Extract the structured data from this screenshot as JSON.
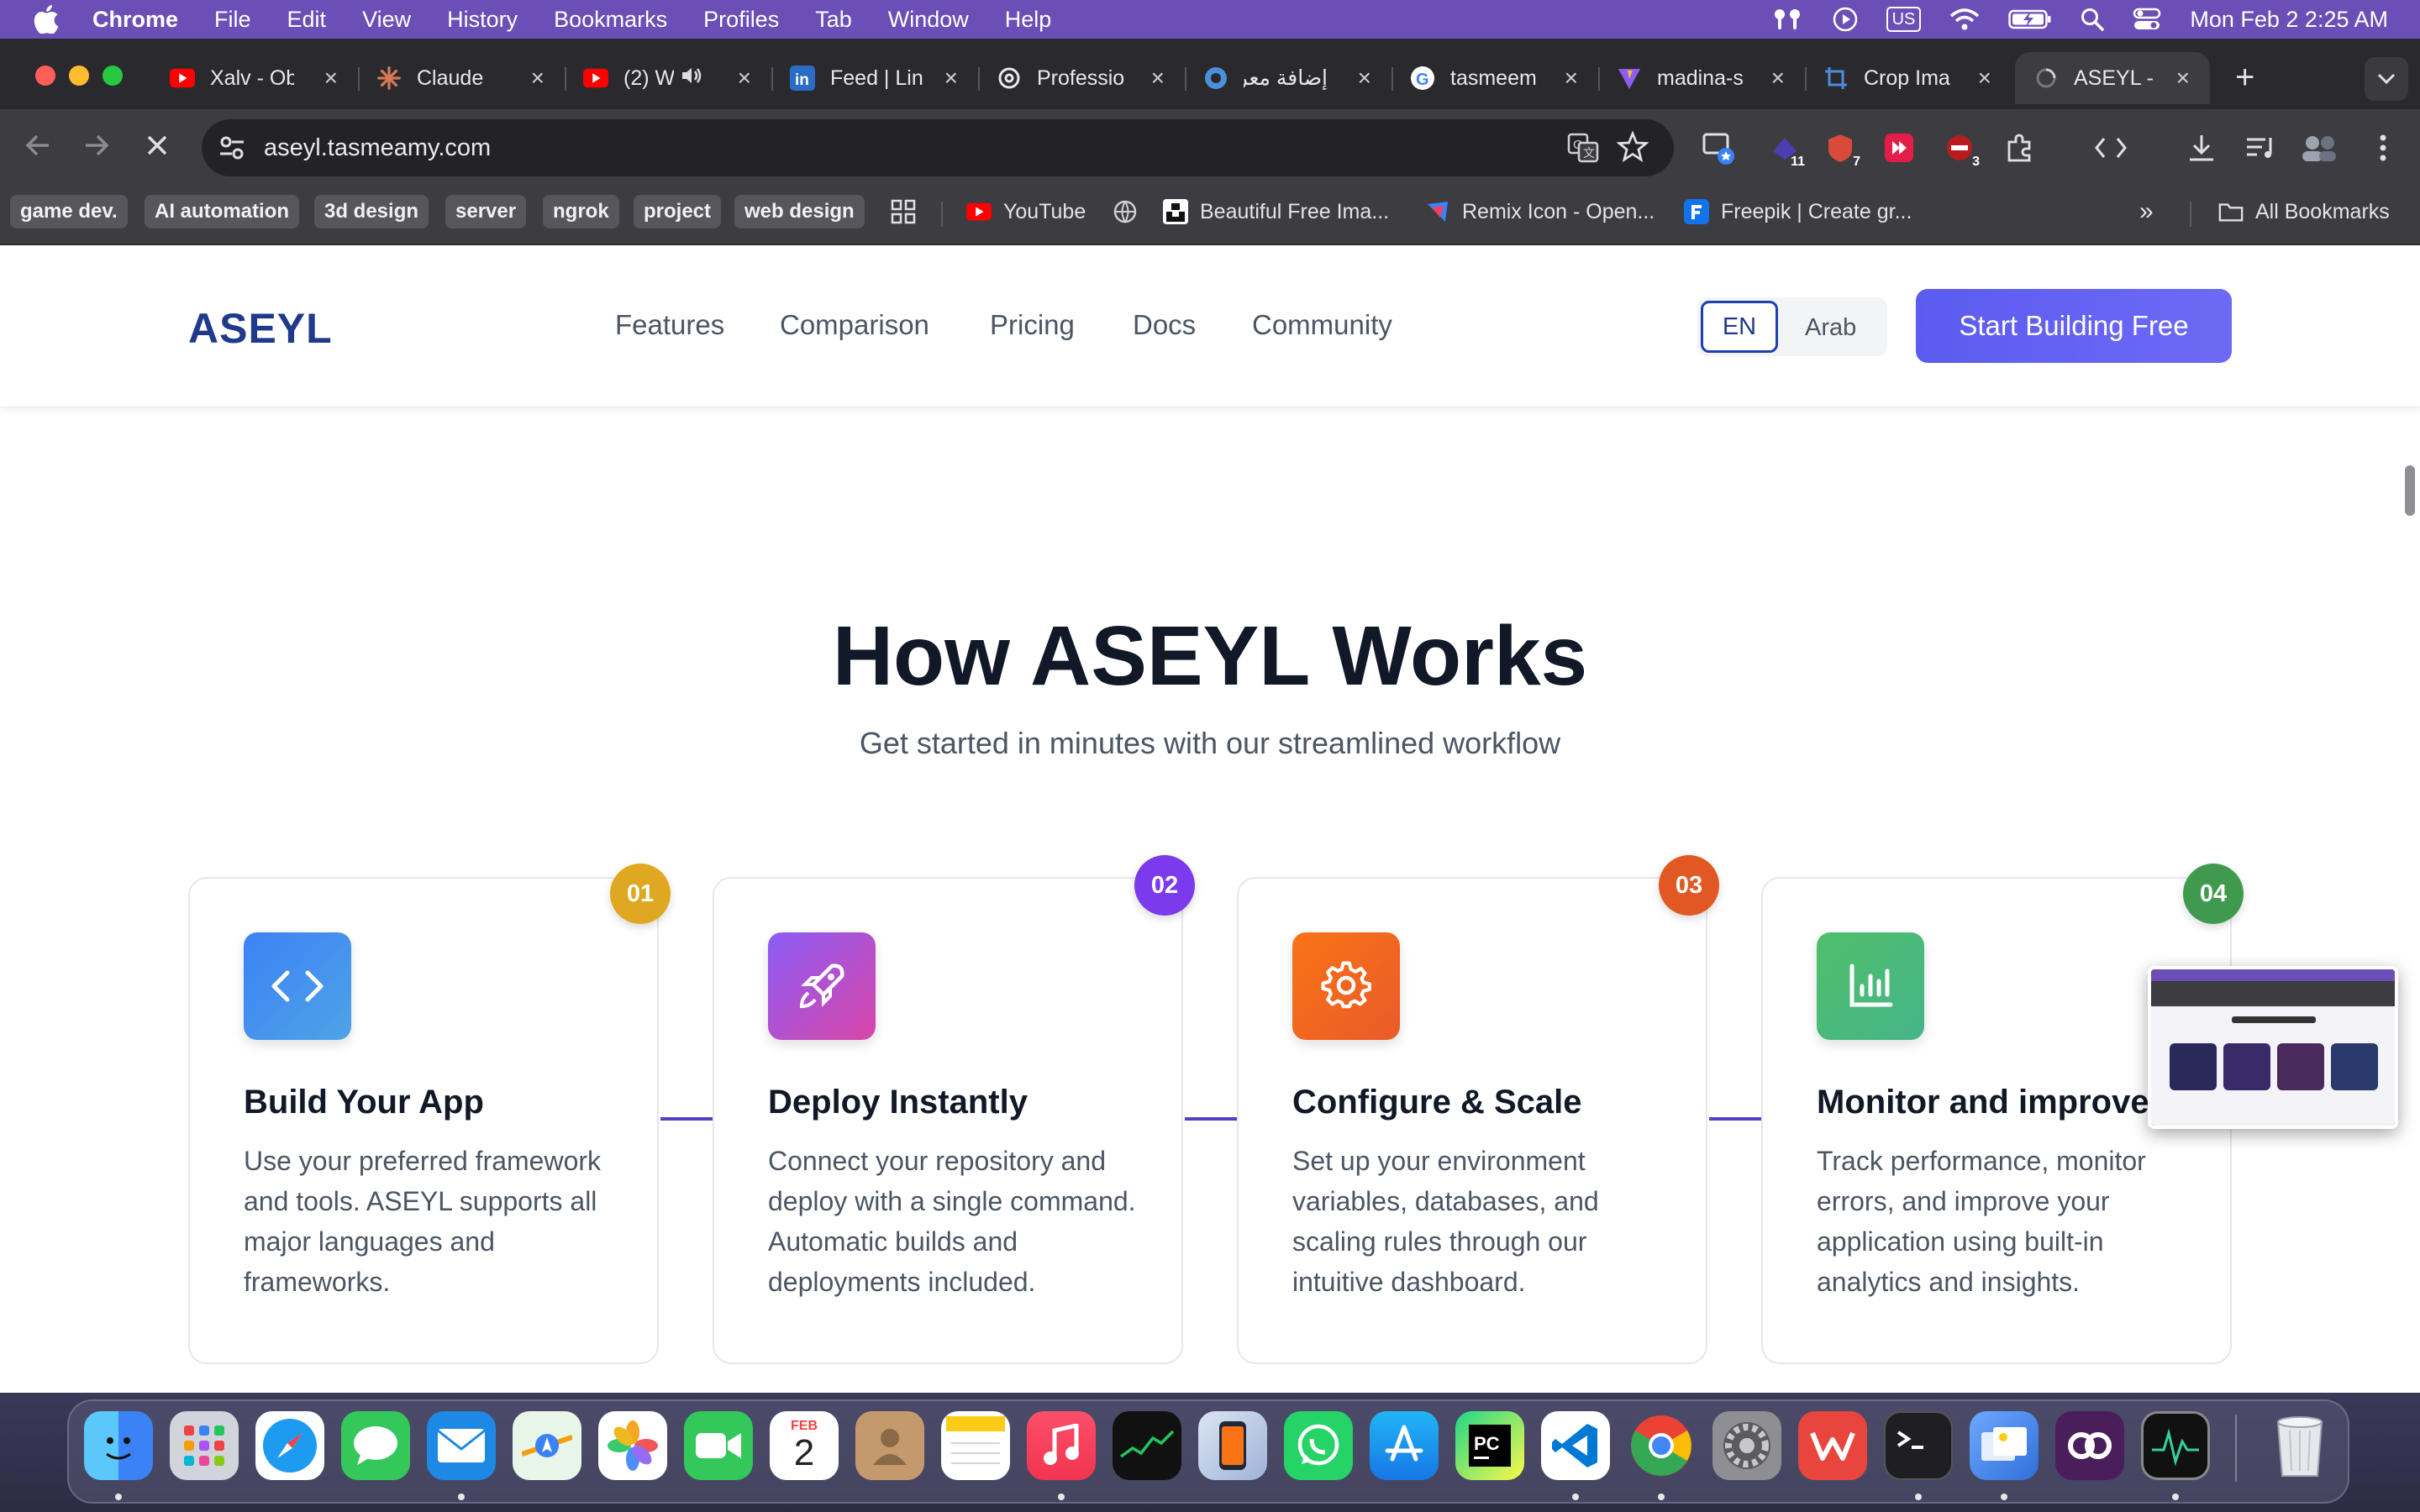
{
  "menubar": {
    "app": "Chrome",
    "items": [
      "File",
      "Edit",
      "View",
      "History",
      "Bookmarks",
      "Profiles",
      "Tab",
      "Window",
      "Help"
    ],
    "input_source": "US",
    "clock": "Mon Feb 2  2:25 AM"
  },
  "tabs": [
    {
      "title": "Xalv - Ob",
      "icon": "youtube-icon"
    },
    {
      "title": "Claude",
      "icon": "claude-icon"
    },
    {
      "title": "(2) W",
      "icon": "youtube-icon"
    },
    {
      "title": "Feed | Lin",
      "icon": "linkedin-icon"
    },
    {
      "title": "Professio",
      "icon": "openai-icon"
    },
    {
      "title": "إضافة معرض",
      "icon": "site-icon"
    },
    {
      "title": "tasmeem",
      "icon": "google-icon"
    },
    {
      "title": "madina-s",
      "icon": "vite-icon"
    },
    {
      "title": "Crop Ima",
      "icon": "crop-icon"
    },
    {
      "title": "ASEYL - ",
      "icon": "loading-icon"
    }
  ],
  "toolbar": {
    "url": "aseyl.tasmeamy.com",
    "extension_badges": [
      "11",
      "7",
      "3"
    ]
  },
  "bookmarks": {
    "folders": [
      "game dev.",
      "AI automation",
      "3d design",
      "server",
      "ngrok",
      "project",
      "web design"
    ],
    "links": [
      "YouTube",
      "Beautiful Free Ima...",
      "Remix Icon - Open...",
      "Freepik | Create gr..."
    ],
    "all": "All Bookmarks"
  },
  "site": {
    "logo": "ASEYL",
    "nav": [
      "Features",
      "Comparison",
      "Pricing",
      "Docs",
      "Community"
    ],
    "lang_en": "EN",
    "lang_ar": "Arab",
    "cta": "Start Building Free",
    "section_title": "How ASEYL Works",
    "section_subtitle": "Get started in minutes with our streamlined workflow",
    "steps": [
      {
        "num": "01",
        "title": "Build Your App",
        "desc": "Use your preferred framework and tools. ASEYL supports all major languages and frameworks.",
        "icon": "code-icon",
        "badge_color": "#e6a817"
      },
      {
        "num": "02",
        "title": "Deploy Instantly",
        "desc": "Connect your repository and deploy with a single command. Automatic builds and deployments included.",
        "icon": "rocket-icon",
        "badge_color": "#7c3aed"
      },
      {
        "num": "03",
        "title": "Configure & Scale",
        "desc": "Set up your environment variables, databases, and scaling rules through our intuitive dashboard.",
        "icon": "gear-icon",
        "badge_color": "#e25822"
      },
      {
        "num": "04",
        "title": "Monitor and improve",
        "desc": "Track performance, monitor errors, and improve your application using built-in analytics and insights.",
        "icon": "bar-chart-icon",
        "badge_color": "#3f9a4e"
      }
    ]
  },
  "dock": {
    "calendar_month": "FEB",
    "calendar_day": "2",
    "apps": [
      "finder",
      "launchpad",
      "safari",
      "messages",
      "mail",
      "maps",
      "photos",
      "facetime",
      "calendar",
      "contacts",
      "notes",
      "music",
      "stocks",
      "iphone-mirroring",
      "whatsapp",
      "app-store",
      "pycharm",
      "vscode",
      "chrome",
      "system-settings",
      "wps-office",
      "terminal",
      "preview",
      "creative-cloud",
      "activity-monitor",
      "trash"
    ]
  }
}
